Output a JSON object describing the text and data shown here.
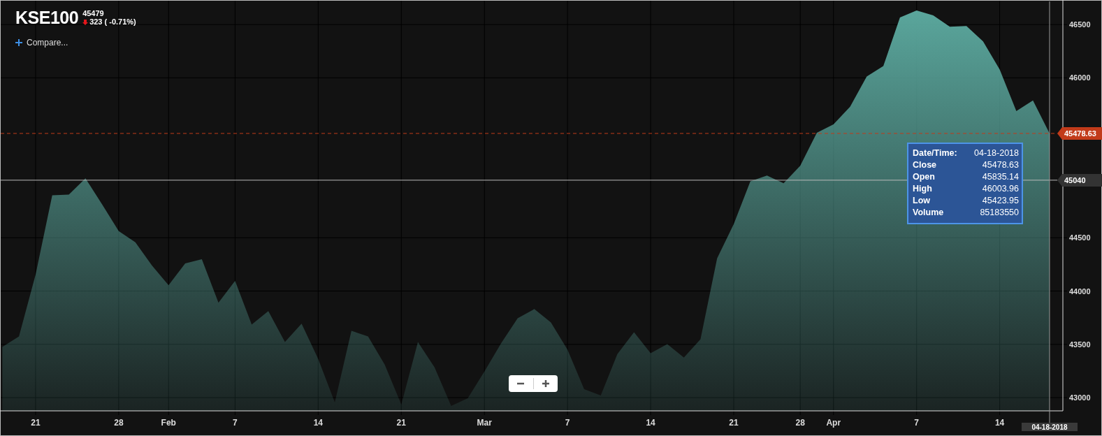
{
  "symbol": {
    "name": "KSE100",
    "price": "45479",
    "change": "323 ( -0.71%)"
  },
  "compare": {
    "label": "Compare..."
  },
  "chart_data": {
    "type": "area",
    "categories": [
      null,
      null,
      "21",
      null,
      null,
      null,
      null,
      "28",
      null,
      null,
      "Feb",
      null,
      null,
      null,
      "7",
      null,
      null,
      null,
      null,
      "14",
      null,
      null,
      null,
      null,
      "21",
      null,
      null,
      null,
      null,
      "Mar",
      null,
      null,
      null,
      null,
      "7",
      null,
      null,
      null,
      null,
      "14",
      null,
      null,
      null,
      null,
      "21",
      null,
      null,
      null,
      "28",
      null,
      "Apr",
      null,
      null,
      null,
      null,
      "7",
      null,
      null,
      null,
      null,
      "14",
      null,
      null,
      null
    ],
    "series": [
      {
        "color": "#5aa69c",
        "values": [
          43475,
          43574,
          44154,
          44899,
          44905,
          45057,
          44813,
          44563,
          44457,
          44240,
          44055,
          44259,
          44299,
          43890,
          44095,
          43686,
          43811,
          43521,
          43693,
          43363,
          42955,
          43627,
          43574,
          43310,
          42935,
          43521,
          43284,
          42922,
          42994,
          43245,
          43508,
          43745,
          43831,
          43706,
          43449,
          43080,
          43020,
          43409,
          43614,
          43416,
          43502,
          43376,
          43548,
          44306,
          44628,
          45030,
          45083,
          45011,
          45175,
          45485,
          45564,
          45729,
          46012,
          46111,
          46566,
          46632,
          46586,
          46480,
          46487,
          46342,
          46078,
          45689,
          45788,
          45479
        ]
      }
    ],
    "ylim": [
      42876,
      46724
    ],
    "yticks": [
      43000,
      43500,
      44000,
      44500,
      46000,
      46500
    ],
    "grid": true,
    "ref_lines": [
      {
        "axis": "y",
        "value": 45478.63,
        "label": "45478.63",
        "color": "#c23b1a"
      },
      {
        "axis": "y",
        "value": 45040,
        "label": "45040",
        "color": "#bbbbbb"
      }
    ]
  },
  "crosshair": {
    "date_label": "04-18-2018"
  },
  "tooltip": {
    "rows": [
      {
        "label": "Date/Time:",
        "value": "04-18-2018"
      },
      {
        "label": "Close",
        "value": "45478.63"
      },
      {
        "label": "Open",
        "value": "45835.14"
      },
      {
        "label": "High",
        "value": "46003.96"
      },
      {
        "label": "Low",
        "value": "45423.95"
      },
      {
        "label": "Volume",
        "value": "85183550"
      }
    ]
  },
  "zoom_controls": {
    "buttons": [
      {
        "kind": "zoom-out"
      },
      {
        "kind": "zoom-in"
      }
    ]
  }
}
